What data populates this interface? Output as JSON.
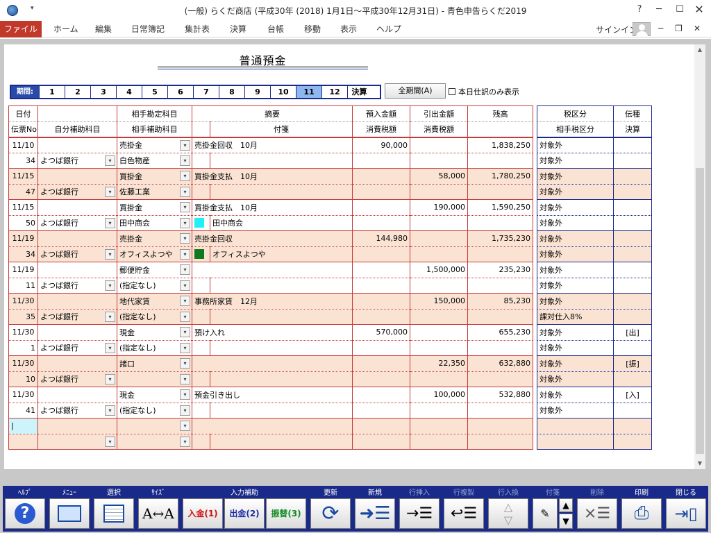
{
  "window": {
    "title": "(一般) らくだ商店 (平成30年 (2018) 1月1日～平成30年12月31日) - 青色申告らくだ2019",
    "help": "?",
    "quick_access": "▾"
  },
  "menu": {
    "items": [
      "ファイル",
      "ホーム",
      "編集",
      "日常簿記",
      "集計表",
      "決算",
      "台帳",
      "移動",
      "表示",
      "ヘルプ"
    ],
    "signin": "サインイン"
  },
  "doc_title": "普通預金",
  "period": {
    "label": "期間:",
    "months": [
      "1",
      "2",
      "3",
      "4",
      "5",
      "6",
      "7",
      "8",
      "9",
      "10",
      "11",
      "12"
    ],
    "active": "11",
    "kessan": "決算",
    "all_button": "全期間(A)",
    "today_only": "本日仕訳のみ表示"
  },
  "ledger": {
    "header_top": [
      "日付",
      "",
      "相手勘定科目",
      "摘要",
      "預入金額",
      "引出金額",
      "残高"
    ],
    "header_bottom": [
      "伝票No",
      "自分補助科目",
      "相手補助科目",
      "",
      "付箋",
      "消費税額",
      "消費税額",
      ""
    ],
    "rows": [
      {
        "date": "11/10",
        "no": "34",
        "self_sub": "よつば銀行",
        "account": "売掛金",
        "sub": "白色物産",
        "memo": "売掛金回収　10月",
        "tag": "",
        "tag_color": "",
        "deposit": "90,000",
        "withdraw": "",
        "balance": "1,838,250",
        "shade": false
      },
      {
        "date": "11/15",
        "no": "47",
        "self_sub": "よつば銀行",
        "account": "買掛金",
        "sub": "佐藤工業",
        "memo": "買掛金支払　10月",
        "tag": "",
        "tag_color": "",
        "deposit": "",
        "withdraw": "58,000",
        "balance": "1,780,250",
        "shade": true
      },
      {
        "date": "11/15",
        "no": "50",
        "self_sub": "よつば銀行",
        "account": "買掛金",
        "sub": "田中商会",
        "memo": "買掛金支払　10月",
        "tag": "田中商会",
        "tag_color": "#22f0f8",
        "deposit": "",
        "withdraw": "190,000",
        "balance": "1,590,250",
        "shade": false
      },
      {
        "date": "11/19",
        "no": "34",
        "self_sub": "よつば銀行",
        "account": "売掛金",
        "sub": "オフィスよつや",
        "memo": "売掛金回収",
        "tag": "オフィスよつや",
        "tag_color": "#0f7a1e",
        "deposit": "144,980",
        "withdraw": "",
        "balance": "1,735,230",
        "shade": true
      },
      {
        "date": "11/19",
        "no": "11",
        "self_sub": "よつば銀行",
        "account": "郵便貯金",
        "sub": "(指定なし)",
        "memo": "",
        "tag": "",
        "tag_color": "",
        "deposit": "",
        "withdraw": "1,500,000",
        "balance": "235,230",
        "shade": false
      },
      {
        "date": "11/30",
        "no": "35",
        "self_sub": "よつば銀行",
        "account": "地代家賃",
        "sub": "(指定なし)",
        "memo": "事務所家賃　12月",
        "tag": "",
        "tag_color": "",
        "deposit": "",
        "withdraw": "150,000",
        "balance": "85,230",
        "shade": true
      },
      {
        "date": "11/30",
        "no": "1",
        "self_sub": "よつば銀行",
        "account": "現金",
        "sub": "(指定なし)",
        "memo": "預け入れ",
        "tag": "",
        "tag_color": "",
        "deposit": "570,000",
        "withdraw": "",
        "balance": "655,230",
        "shade": false
      },
      {
        "date": "11/30",
        "no": "10",
        "self_sub": "よつば銀行",
        "account": "諸口",
        "sub": "",
        "memo": "",
        "tag": "",
        "tag_color": "",
        "deposit": "",
        "withdraw": "22,350",
        "balance": "632,880",
        "shade": true
      },
      {
        "date": "11/30",
        "no": "41",
        "self_sub": "よつば銀行",
        "account": "現金",
        "sub": "(指定なし)",
        "memo": "預金引き出し",
        "tag": "",
        "tag_color": "",
        "deposit": "",
        "withdraw": "100,000",
        "balance": "532,880",
        "shade": false
      }
    ]
  },
  "tax": {
    "header_top": [
      "税区分",
      "伝種"
    ],
    "header_bottom": [
      "相手税区分",
      "決算"
    ],
    "rows": [
      {
        "tax": "対象外",
        "tax2": "対象外",
        "kind": "",
        "kind2": ""
      },
      {
        "tax": "対象外",
        "tax2": "対象外",
        "kind": "",
        "kind2": ""
      },
      {
        "tax": "対象外",
        "tax2": "対象外",
        "kind": "",
        "kind2": ""
      },
      {
        "tax": "対象外",
        "tax2": "対象外",
        "kind": "",
        "kind2": ""
      },
      {
        "tax": "対象外",
        "tax2": "対象外",
        "kind": "",
        "kind2": ""
      },
      {
        "tax": "対象外",
        "tax2": "課対仕入8%",
        "kind": "",
        "kind2": ""
      },
      {
        "tax": "対象外",
        "tax2": "対象外",
        "kind": "[出]",
        "kind2": ""
      },
      {
        "tax": "対象外",
        "tax2": "対象外",
        "kind": "[振]",
        "kind2": ""
      },
      {
        "tax": "対象外",
        "tax2": "対象外",
        "kind": "[入]",
        "kind2": ""
      }
    ]
  },
  "toolbar": {
    "help": "ﾍﾙﾌﾟ",
    "menu": "ﾒﾆｭｰ",
    "select": "選択",
    "size": "ｻｲｽﾞ",
    "input_assist": "入力補助",
    "deposit_btn": "入金(1)",
    "withdraw_btn": "出金(2)",
    "transfer_btn": "振替(3)",
    "update": "更新",
    "new": "新規",
    "row_insert": "行挿入",
    "row_copy": "行複製",
    "row_swap": "行入換",
    "sticky": "付箋",
    "delete": "削除",
    "print": "印刷",
    "close": "閉じる"
  }
}
